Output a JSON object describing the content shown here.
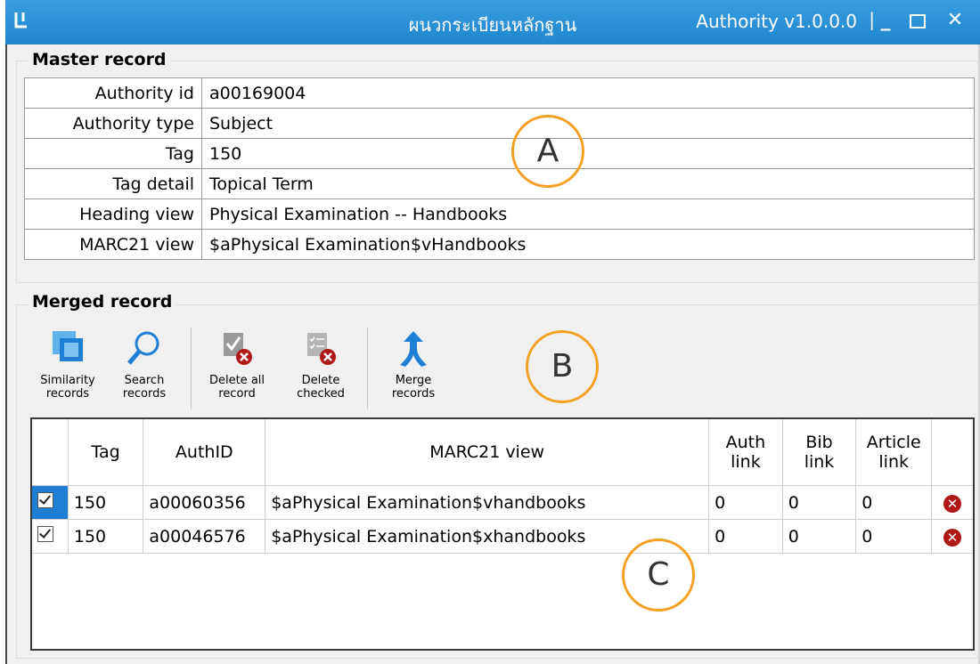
{
  "window": {
    "title": "ผนวกระเบียนหลักฐาน",
    "version": "Authority v1.0.0.0",
    "separator": "|",
    "minimize": "_",
    "close": "✕"
  },
  "master": {
    "group_label": "Master record",
    "rows": [
      {
        "key": "Authority id",
        "value": "a00169004"
      },
      {
        "key": "Authority type",
        "value": "Subject"
      },
      {
        "key": "Tag",
        "value": "150"
      },
      {
        "key": "Tag detail",
        "value": "Topical Term"
      },
      {
        "key": "Heading view",
        "value": "Physical Examination -- Handbooks"
      },
      {
        "key": "MARC21 view",
        "value": "$aPhysical Examination$vHandbooks"
      }
    ]
  },
  "merged": {
    "group_label": "Merged record",
    "toolbar": {
      "similarity": {
        "line1": "Similarity",
        "line2": "records"
      },
      "search": {
        "line1": "Search",
        "line2": "records"
      },
      "delete_all": {
        "line1": "Delete all",
        "line2": "record"
      },
      "delete_checked": {
        "line1": "Delete",
        "line2": "checked"
      },
      "merge": {
        "line1": "Merge",
        "line2": "records"
      }
    },
    "columns": {
      "tag": "Tag",
      "authid": "AuthID",
      "marc": "MARC21 view",
      "auth_link_1": "Auth",
      "auth_link_2": "link",
      "bib_link_1": "Bib",
      "bib_link_2": "link",
      "article_link_1": "Article",
      "article_link_2": "link"
    },
    "rows": [
      {
        "checked": true,
        "tag": "150",
        "authid": "a00060356",
        "marc": "$aPhysical Examination$vhandbooks",
        "auth": "0",
        "bib": "0",
        "article": "0"
      },
      {
        "checked": true,
        "tag": "150",
        "authid": "a00046576",
        "marc": "$aPhysical Examination$xhandbooks",
        "auth": "0",
        "bib": "0",
        "article": "0"
      }
    ]
  },
  "annotations": {
    "a": "A",
    "b": "B",
    "c": "C"
  },
  "colors": {
    "titlebar": "#2a92d8",
    "accent_circle": "#f4a023",
    "delete": "#b01818"
  }
}
